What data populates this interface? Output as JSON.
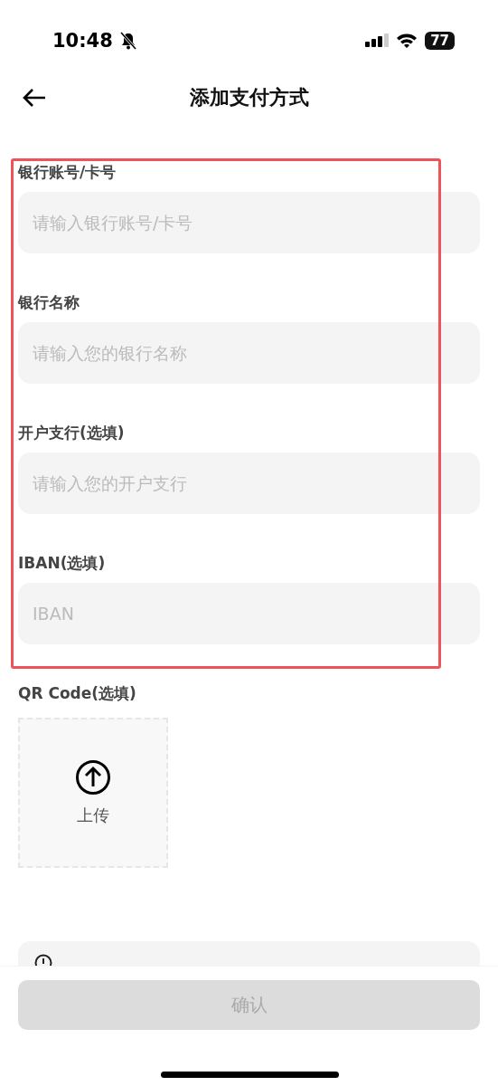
{
  "status_bar": {
    "time": "10:48",
    "battery": "77"
  },
  "header": {
    "title": "添加支付方式"
  },
  "highlight": {
    "shown": true
  },
  "fields": [
    {
      "label": "银行账号/卡号",
      "placeholder": "请输入银行账号/卡号"
    },
    {
      "label": "银行名称",
      "placeholder": "请输入您的银行名称"
    },
    {
      "label": "开户支行(选填)",
      "placeholder": "请输入您的开户支行"
    },
    {
      "label": "IBAN(选填)",
      "placeholder": "IBAN"
    }
  ],
  "qr": {
    "label": "QR Code(选填)",
    "upload": "上传"
  },
  "confirm": {
    "label": "确认",
    "disabled": true
  }
}
